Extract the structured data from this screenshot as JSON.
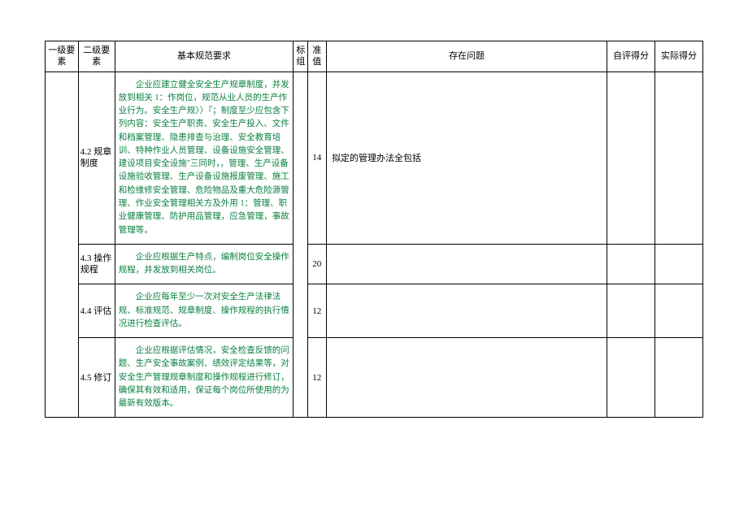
{
  "headers": {
    "level1": "一级要素",
    "level2": "二级要素",
    "basic_req": "基本规范要求",
    "bracket": "标组",
    "standard_value": "准值",
    "issues": "存在问题",
    "self_score": "自评得分",
    "actual_score": "实际得分"
  },
  "rows": [
    {
      "level2": "4.2 规章制度",
      "requirement": "企业应建立健全安全生产规章制度，并发放到相关 1：作岗位，规范从业人员的生产作业行为。安全生产规〉〉『；制度至少应包含下列内容：安全生产职责、安全生产投入、文件和档案管理、隐患排查与治理、安全教育培训、特种作业人员管理、设备设施安全管理、建设项目安全设施\"三同时，，管理、生产设备设施验收管理、生产设备设施报废管理、施工和检维修安全管理、危险物品及重大危险源管理、作业安全管理相关方及外用 1：管理、职业健康管理、防护用品管理，应急管理，事故管理等。",
      "score": "14",
      "issues": "拟定的管理办法全包括"
    },
    {
      "level2": "4.3 操作规程",
      "requirement": "企业应根据生产特点，编制岗位安全操作规程，并发放到相关岗位。",
      "score": "20",
      "issues": ""
    },
    {
      "level2": "4.4 评估",
      "requirement": "企业应每年至少一次对安全生产法律法规、标准规范、规章制度、操作规程的执行情况进行检查评估。",
      "score": "12",
      "issues": ""
    },
    {
      "level2": "4.5 修订",
      "requirement": "企业应根据评估情况，安全检查反馈的问题、生产安全事故案例、绩效评定结果等，对安全生产管理规章制度和操作规程进行修订，确保其有效和适用，保证每个岗位所使用的为最新有效版本。",
      "score": "12",
      "issues": ""
    }
  ]
}
